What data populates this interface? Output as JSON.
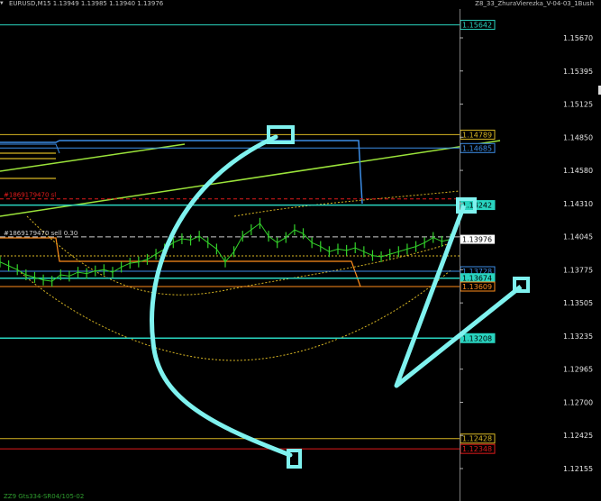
{
  "window": {
    "title_left": "EURUSD,M15  1.13949 1.13985 1.13940 1.13976",
    "title_right": "Z8_33_ZhuraVierezka_V-04-03_1Bush",
    "footer_text": "ZZ9 Gts334-SR04/105-02"
  },
  "colors": {
    "background": "#000000",
    "price": "#33d12a",
    "cyan_line": "#29d4c0",
    "blue_line": "#3c8de6",
    "gold_line": "#d8b623",
    "orange_line": "#ff8c1a",
    "red_line": "#e11b1b",
    "trend": "#9be33a",
    "annotation": "#7ff2ef"
  },
  "chart_data": {
    "type": "line",
    "title": "EURUSD,M15",
    "symbol": "EURUSD",
    "timeframe": "M15",
    "ylim": [
      1.12125,
      1.15765
    ],
    "axis_ticks": [
      "1.15670",
      "1.15395",
      "1.15125",
      "1.14850",
      "1.14580",
      "1.14310",
      "1.14045",
      "1.13775",
      "1.13505",
      "1.13235",
      "1.12965",
      "1.12700",
      "1.12425",
      "1.12155"
    ],
    "current_price": "1.13976",
    "level_labels": [
      {
        "value": 1.15642,
        "text": "1.15642",
        "color": "#29d4c0"
      },
      {
        "value": 1.14789,
        "text": "1.14789",
        "color": "#d8b623"
      },
      {
        "value": 1.14685,
        "text": "1.14685",
        "color": "#3c8de6"
      },
      {
        "value": 1.14242,
        "text": "1.14242",
        "color": "#29d4c0",
        "fill": true
      },
      {
        "value": 1.13728,
        "text": "1.13728",
        "color": "#3c8de6"
      },
      {
        "value": 1.13674,
        "text": "1.13674",
        "color": "#29d4c0",
        "fill": true
      },
      {
        "value": 1.13609,
        "text": "1.13609",
        "color": "#ff8c1a"
      },
      {
        "value": 1.13208,
        "text": "1.13208",
        "color": "#29d4c0",
        "fill": true
      },
      {
        "value": 1.12428,
        "text": "1.12428",
        "color": "#d8b623"
      },
      {
        "value": 1.12348,
        "text": "1.12348",
        "color": "#e11b1b"
      }
    ],
    "order_labels": [
      {
        "value": 1.1429,
        "text": "#1869179470 sl",
        "color": "#e11b1b"
      },
      {
        "value": 1.13995,
        "text": "#1869179470 sell 0.30",
        "color": "#d0d0d0"
      }
    ],
    "price_series": [
      1.138,
      1.1377,
      1.1374,
      1.137,
      1.1368,
      1.1366,
      1.1365,
      1.137,
      1.1369,
      1.1372,
      1.1371,
      1.1373,
      1.1374,
      1.1372,
      1.1376,
      1.1379,
      1.138,
      1.1382,
      1.1386,
      1.139,
      1.1395,
      1.1398,
      1.1397,
      1.14,
      1.1395,
      1.139,
      1.138,
      1.1388,
      1.14,
      1.1405,
      1.141,
      1.14,
      1.1395,
      1.1399,
      1.1405,
      1.1402,
      1.1395,
      1.1392,
      1.1388,
      1.139,
      1.1389,
      1.1391,
      1.1388,
      1.1385,
      1.1384,
      1.1386,
      1.1388,
      1.139,
      1.1392,
      1.1395,
      1.1399,
      1.1396,
      1.13976
    ]
  }
}
